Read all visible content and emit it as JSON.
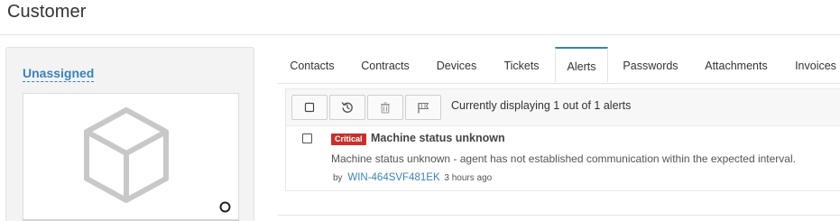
{
  "page": {
    "title": "Customer"
  },
  "left_panel": {
    "assigned_label": "Unassigned",
    "image_icon": "cube-icon",
    "status_icon": "circle-outline-icon"
  },
  "tabs": [
    {
      "label": "Contacts",
      "active": false
    },
    {
      "label": "Contracts",
      "active": false
    },
    {
      "label": "Devices",
      "active": false
    },
    {
      "label": "Tickets",
      "active": false
    },
    {
      "label": "Alerts",
      "active": true
    },
    {
      "label": "Passwords",
      "active": false
    },
    {
      "label": "Attachments",
      "active": false
    },
    {
      "label": "Invoices",
      "active": false
    }
  ],
  "alerts": {
    "toolbar": {
      "buttons": [
        {
          "icon": "checkbox-icon"
        },
        {
          "icon": "history-icon"
        },
        {
          "icon": "trash-icon"
        },
        {
          "icon": "flag-icon"
        }
      ],
      "status_text": "Currently displaying 1 out of 1 alerts"
    },
    "items": [
      {
        "severity": "Critical",
        "title": "Machine status unknown",
        "description": "Machine status unknown - agent has not established communication within the expected interval.",
        "by_label": "by",
        "device": "WIN-464SVF481EK",
        "time": "3 hours ago"
      }
    ]
  },
  "colors": {
    "accent": "#3a82b8",
    "critical": "#c9302c"
  }
}
